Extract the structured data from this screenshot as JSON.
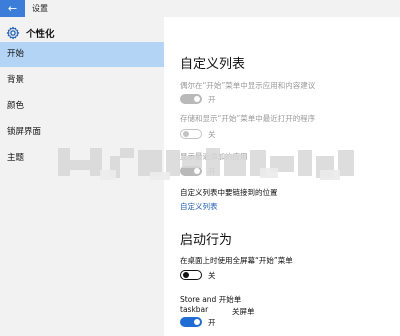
{
  "window": {
    "title": "设置",
    "back_icon": "←"
  },
  "sidebar": {
    "title": "个性化",
    "items": [
      {
        "label": "开始",
        "active": true
      },
      {
        "label": "背景",
        "active": false
      },
      {
        "label": "颜色",
        "active": false
      },
      {
        "label": "锁屏界面",
        "active": false
      },
      {
        "label": "主题",
        "active": false
      }
    ]
  },
  "main": {
    "section1_title": "自定义列表",
    "options": [
      {
        "label": "偶尔在“开始”菜单中显示应用和内容建议",
        "state": "开"
      },
      {
        "label": "存储和显示“开始”菜单中最近打开的程序",
        "state": "关"
      },
      {
        "label": "显示最近添加的应用",
        "state": "开"
      }
    ],
    "custom_list_label": "自定义列表中要链接到的位置",
    "custom_list_link": "自定义列表",
    "section2_title": "启动行为",
    "fullscreen_label": "在桌面上时使用全屏幕“开始”菜单",
    "fullscreen_state": "关",
    "taskbar_label_line1": "Store and 开始单",
    "taskbar_label_line2": "taskbar",
    "taskbar_state_text": "开",
    "taskbar_state_secondary": "关屏单"
  },
  "colors": {
    "accent": "#1e6cd4",
    "sidebar_active": "#b3d4f5",
    "back_button": "#3b7dd8"
  }
}
